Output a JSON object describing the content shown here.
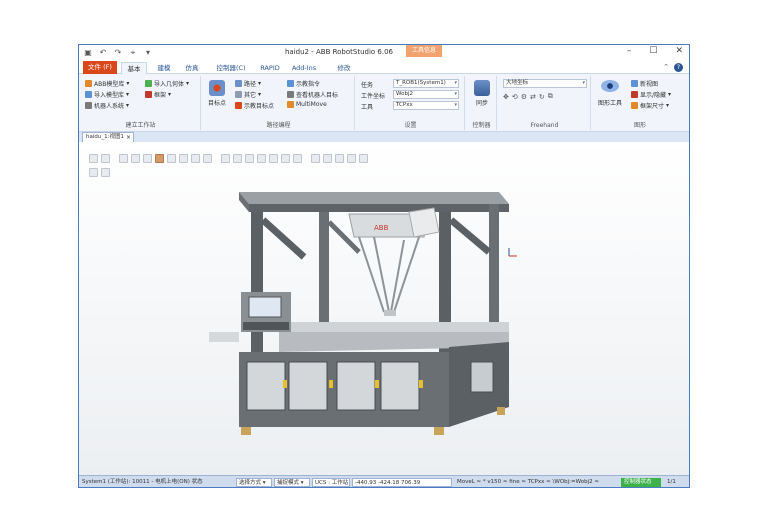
{
  "window": {
    "title": "haidu2 - ABB RobotStudio 6.06",
    "tool_tab": "工具信息"
  },
  "quick_access": {
    "icons": [
      "save-icon",
      "undo-icon",
      "redo-icon",
      "link-icon",
      "dropdown-icon"
    ]
  },
  "tabs": [
    {
      "label": "文件 (F)"
    },
    {
      "label": "基本"
    },
    {
      "label": "建模"
    },
    {
      "label": "仿真"
    },
    {
      "label": "控制器(C)"
    },
    {
      "label": "RAPID"
    },
    {
      "label": "Add-Ins"
    },
    {
      "label": "修改"
    }
  ],
  "ribbon": {
    "build_station": {
      "label": "建立工作站",
      "items": [
        "ABB模型库",
        "导入模型库",
        "机器人系统",
        "导入几何体",
        "框架"
      ]
    },
    "path_programming": {
      "label": "路径编程",
      "target_point": "目标点",
      "items": [
        "路径",
        "其它",
        "示教目标点",
        "示教指令",
        "查看机器人目标",
        "MultiMove"
      ]
    },
    "settings": {
      "label": "设置",
      "task_label": "任务",
      "task_value": "T_ROB1(System1)",
      "wobj_label": "工件坐标",
      "wobj_value": "Wobj2",
      "tool_label": "工具",
      "tool_value": "TCPxx"
    },
    "controller": {
      "label": "控制器",
      "sync": "同步"
    },
    "freehand": {
      "label": "Freehand",
      "coord_value": "大地坐标"
    },
    "graphics": {
      "label": "图形",
      "graphics_tool": "图形工具",
      "items": [
        "新视图",
        "显示/隐藏",
        "框架尺寸"
      ]
    }
  },
  "document": {
    "tab_label": "haidu_1:视图1",
    "close": "×"
  },
  "statusbar": {
    "controller_status": "System1 (工作站): 10011 - 电机上电(ON) 状态",
    "select_mode": "选择方式",
    "snap_mode": "捕捉模式",
    "ucs": "UCS : 工作站",
    "coords": "-440.93  -424.18  706.39",
    "instruction": "MoveL ≈ * v150 ≈ fine ≈ TCPxx ≈ \\WObj:=Wobj2 ≈",
    "controller_state": "控制器状态",
    "count": "1/1"
  },
  "colors": {
    "accent": "#2b5797",
    "file_tab": "#d9471a",
    "status_green": "#3db24a"
  }
}
